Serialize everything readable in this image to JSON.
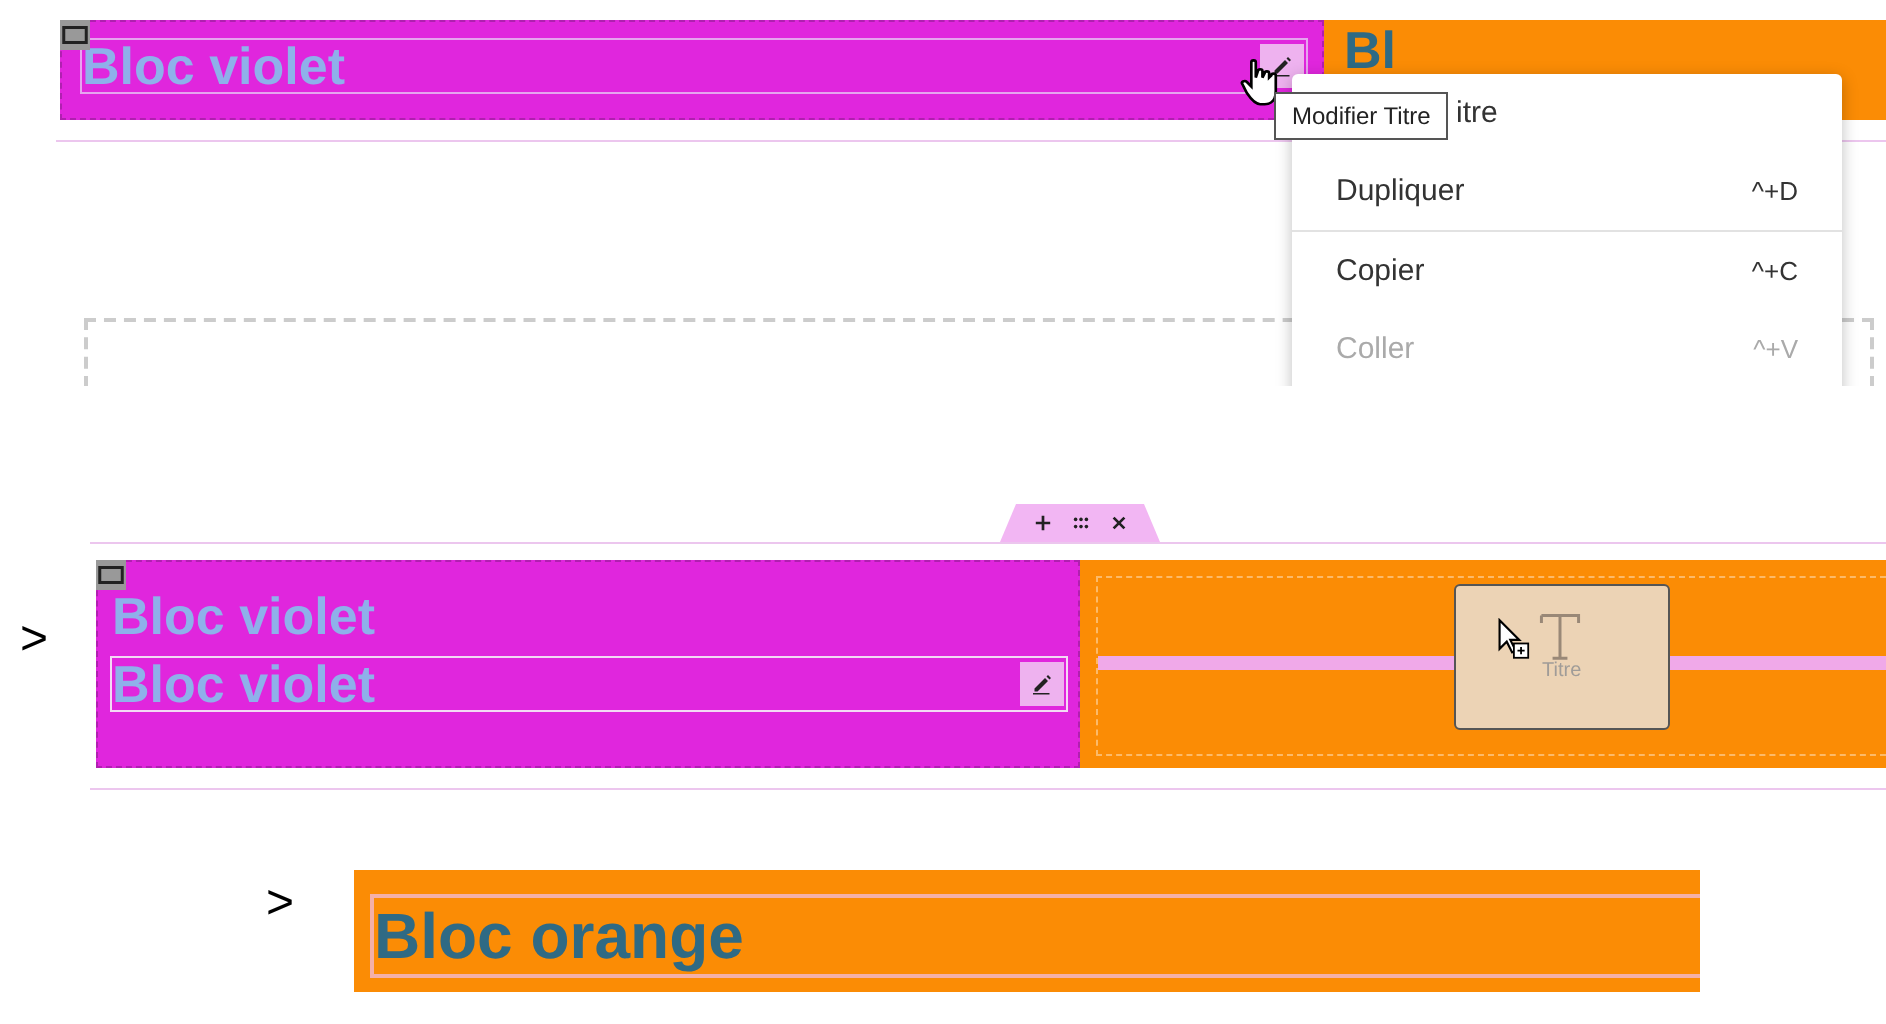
{
  "top_view": {
    "violet_column": {
      "heading": "Bloc violet"
    },
    "orange_column": {
      "heading": "Bl"
    },
    "tooltip": "Modifier Titre",
    "context_menu": [
      {
        "label": "itre",
        "disabled": false
      },
      {
        "label": "Dupliquer",
        "shortcut": "^+D",
        "disabled": false
      },
      {
        "label": "Copier",
        "shortcut": "^+C",
        "disabled": false,
        "divider_before": true
      },
      {
        "label": "Coller",
        "shortcut": "^+V",
        "disabled": true
      }
    ]
  },
  "middle_view": {
    "marker": ">",
    "violet_column": {
      "headings": [
        {
          "text": "Bloc violet",
          "selected": false
        },
        {
          "text": "Bloc violet",
          "selected": true
        }
      ]
    },
    "dragged_widget": {
      "label": "Titre"
    }
  },
  "bottom_view": {
    "marker": ">",
    "heading": "Bloc orange"
  }
}
